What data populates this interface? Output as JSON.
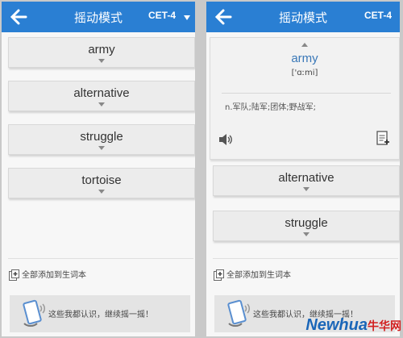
{
  "left_screen": {
    "header": {
      "title": "摇动模式",
      "level": "CET-4"
    },
    "words": [
      "army",
      "alternative",
      "struggle",
      "tortoise"
    ],
    "add_all": "全部添加到生词本",
    "banner_text": "这些我都认识，继续摇一摇！"
  },
  "right_screen": {
    "header": {
      "title": "摇动模式",
      "level": "CET-4"
    },
    "expanded": {
      "word": "army",
      "phonetic": "['ɑːmi]",
      "definition": "n.军队;陆军;团体;野战军;"
    },
    "words": [
      "alternative",
      "struggle"
    ],
    "add_all": "全部添加到生词本",
    "banner_text": "这些我都认识，继续摇一摇！"
  },
  "watermark": {
    "brand": "Newhua",
    "site": "牛华网"
  },
  "colors": {
    "header": "#2a7fd3",
    "word_highlight": "#3a78b8"
  }
}
